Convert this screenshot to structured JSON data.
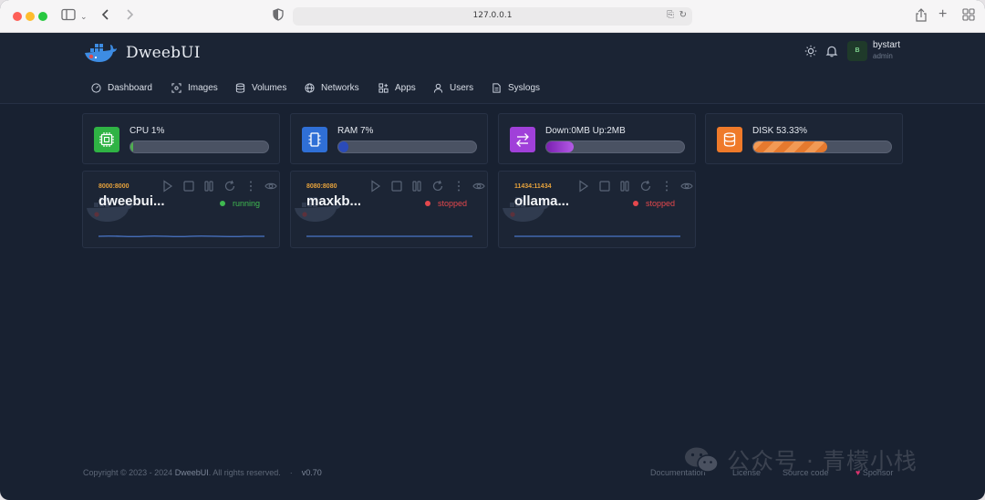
{
  "browser": {
    "url": "127.0.0.1"
  },
  "app": {
    "brand": "DweebUI",
    "user": {
      "initial": "B",
      "name": "bystart",
      "role": "admin"
    }
  },
  "nav": [
    {
      "label": "Dashboard",
      "icon": "dashboard-icon"
    },
    {
      "label": "Images",
      "icon": "image-icon"
    },
    {
      "label": "Volumes",
      "icon": "database-icon"
    },
    {
      "label": "Networks",
      "icon": "globe-icon"
    },
    {
      "label": "Apps",
      "icon": "apps-icon"
    },
    {
      "label": "Users",
      "icon": "user-icon"
    },
    {
      "label": "Syslogs",
      "icon": "file-icon"
    }
  ],
  "stats": [
    {
      "label": "CPU 1%",
      "percent": 1,
      "color": "#2fb344",
      "bar": "#4fae4f"
    },
    {
      "label": "RAM 7%",
      "percent": 7,
      "color": "#2f6fd6",
      "bar": "#2b4bb8"
    },
    {
      "label": "Down:0MB Up:2MB",
      "percent": 20,
      "color": "#a040d9",
      "bar": "#9b2fc9"
    },
    {
      "label": "DISK 53.33%",
      "percent": 53.33,
      "color": "#ef7a2a",
      "bar": "#f08a3c"
    }
  ],
  "containers": [
    {
      "ports": "8000:8000",
      "name": "dweebui...",
      "status": "running",
      "status_color": "#3fb950"
    },
    {
      "ports": "8080:8080",
      "name": "maxkb...",
      "status": "stopped",
      "status_color": "#e5484d"
    },
    {
      "ports": "11434:11434",
      "name": "ollama...",
      "status": "stopped",
      "status_color": "#e5484d"
    }
  ],
  "footer": {
    "copyright": "Copyright © 2023 - 2024",
    "brand": "DweebUI",
    "rights": ". All rights reserved.",
    "sep": "·",
    "version": "v0.70",
    "links": [
      "Documentation",
      "License",
      "Source code",
      "Sponsor"
    ]
  },
  "watermark": {
    "text": "公众号 · 青檬小栈"
  }
}
